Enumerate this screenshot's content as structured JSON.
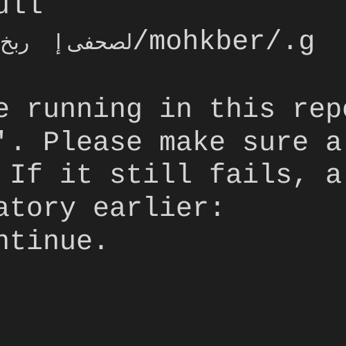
{
  "terminal": {
    "lines": [
      "ull",
      "",
      "",
      "e running in this repo",
      "'. Please make sure a",
      " If it still fails, a",
      "atory earlier:",
      "ntinue."
    ],
    "path_line": {
      "rtl_prefix": "ربخ",
      "separator": "إ",
      "rtl_folder": "لصحفى",
      "path_text": "/mohkber/.g"
    }
  }
}
